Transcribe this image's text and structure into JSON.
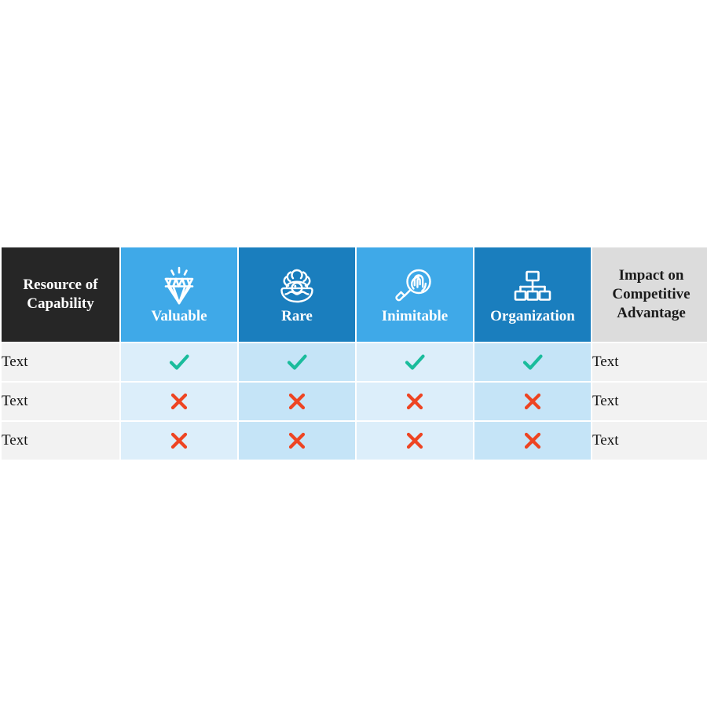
{
  "table": {
    "header": {
      "resource_label": "Resource of Capability",
      "impact_label": "Impact on Competitive Advantage",
      "criteria": [
        {
          "label": "Valuable",
          "icon": "diamond-icon",
          "shade": "light"
        },
        {
          "label": "Rare",
          "icon": "oyster-pearl-icon",
          "shade": "dark"
        },
        {
          "label": "Inimitable",
          "icon": "fingerprint-magnifier-icon",
          "shade": "light"
        },
        {
          "label": "Organization",
          "icon": "org-chart-icon",
          "shade": "dark"
        }
      ]
    },
    "rows": [
      {
        "resource": "Text",
        "impact": "Text",
        "marks": [
          "check",
          "check",
          "check",
          "check"
        ]
      },
      {
        "resource": "Text",
        "impact": "Text",
        "marks": [
          "cross",
          "cross",
          "cross",
          "cross"
        ]
      },
      {
        "resource": "Text",
        "impact": "Text",
        "marks": [
          "cross",
          "cross",
          "cross",
          "cross"
        ]
      }
    ]
  },
  "colors": {
    "header_dark": "#262626",
    "header_blue_light": "#3FA9E8",
    "header_blue_dark": "#1A7EBE",
    "header_gray": "#DCDCDC",
    "cell_blue_light": "#DCEEFA",
    "cell_blue_dark": "#C5E4F7",
    "cell_gray": "#F2F2F2",
    "check_green": "#1ABC9C",
    "cross_red": "#EE4422",
    "page_background": "#FFFFFF"
  }
}
